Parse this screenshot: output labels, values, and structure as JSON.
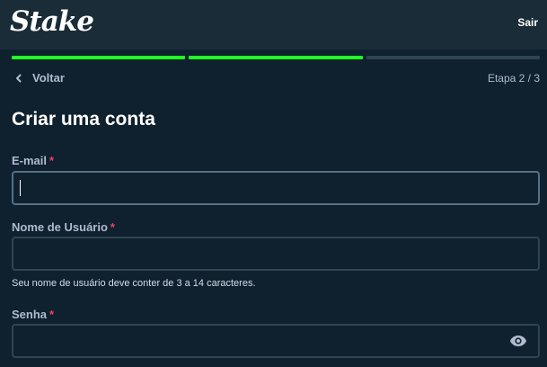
{
  "header": {
    "logo_text": "Stake",
    "logout_label": "Sair"
  },
  "progress": {
    "current_step": 2,
    "total_steps": 3,
    "segments": [
      {
        "state": "complete",
        "color": "#1fff20"
      },
      {
        "state": "complete",
        "color": "#1fff20"
      },
      {
        "state": "pending",
        "color": "#2f4553"
      }
    ]
  },
  "nav": {
    "back_label": "Voltar",
    "step_label": "Etapa 2 / 3"
  },
  "form": {
    "title": "Criar uma conta",
    "required_marker": "*",
    "email": {
      "label": "E-mail",
      "value": ""
    },
    "username": {
      "label": "Nome de Usuário",
      "value": "",
      "hint": "Seu nome de usuário deve conter de 3 a 14 caracteres."
    },
    "password": {
      "label": "Senha",
      "value": "",
      "toggle_icon": "eye-icon"
    }
  },
  "colors": {
    "background": "#0f212e",
    "header": "#1a2c38",
    "input_border": "#2f4553",
    "required": "#ed4163",
    "progress_complete": "#1fff20"
  }
}
